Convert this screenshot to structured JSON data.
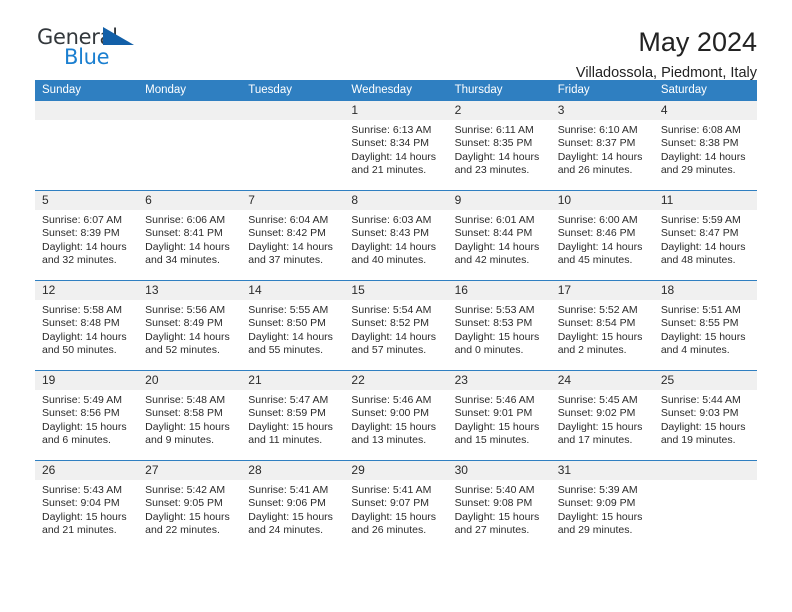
{
  "brand": {
    "name_top": "General",
    "name_bottom": "Blue",
    "triangle_color": "#1360a8",
    "blue_color": "#1b7fd0"
  },
  "header": {
    "month_title": "May 2024",
    "location": "Villadossola, Piedmont, Italy"
  },
  "theme": {
    "header_bg": "#2f7fc1",
    "header_text": "#ffffff",
    "date_band_bg": "#f0f0f0",
    "row_divider": "#2f7fc1"
  },
  "weekdays": [
    "Sunday",
    "Monday",
    "Tuesday",
    "Wednesday",
    "Thursday",
    "Friday",
    "Saturday"
  ],
  "weeks": [
    [
      {
        "day": "",
        "empty": true,
        "sunrise": "",
        "sunset": "",
        "daylight_line1": "",
        "daylight_line2": ""
      },
      {
        "day": "",
        "empty": true,
        "sunrise": "",
        "sunset": "",
        "daylight_line1": "",
        "daylight_line2": ""
      },
      {
        "day": "",
        "empty": true,
        "sunrise": "",
        "sunset": "",
        "daylight_line1": "",
        "daylight_line2": ""
      },
      {
        "day": "1",
        "sunrise": "Sunrise: 6:13 AM",
        "sunset": "Sunset: 8:34 PM",
        "daylight_line1": "Daylight: 14 hours",
        "daylight_line2": "and 21 minutes."
      },
      {
        "day": "2",
        "sunrise": "Sunrise: 6:11 AM",
        "sunset": "Sunset: 8:35 PM",
        "daylight_line1": "Daylight: 14 hours",
        "daylight_line2": "and 23 minutes."
      },
      {
        "day": "3",
        "sunrise": "Sunrise: 6:10 AM",
        "sunset": "Sunset: 8:37 PM",
        "daylight_line1": "Daylight: 14 hours",
        "daylight_line2": "and 26 minutes."
      },
      {
        "day": "4",
        "sunrise": "Sunrise: 6:08 AM",
        "sunset": "Sunset: 8:38 PM",
        "daylight_line1": "Daylight: 14 hours",
        "daylight_line2": "and 29 minutes."
      }
    ],
    [
      {
        "day": "5",
        "sunrise": "Sunrise: 6:07 AM",
        "sunset": "Sunset: 8:39 PM",
        "daylight_line1": "Daylight: 14 hours",
        "daylight_line2": "and 32 minutes."
      },
      {
        "day": "6",
        "sunrise": "Sunrise: 6:06 AM",
        "sunset": "Sunset: 8:41 PM",
        "daylight_line1": "Daylight: 14 hours",
        "daylight_line2": "and 34 minutes."
      },
      {
        "day": "7",
        "sunrise": "Sunrise: 6:04 AM",
        "sunset": "Sunset: 8:42 PM",
        "daylight_line1": "Daylight: 14 hours",
        "daylight_line2": "and 37 minutes."
      },
      {
        "day": "8",
        "sunrise": "Sunrise: 6:03 AM",
        "sunset": "Sunset: 8:43 PM",
        "daylight_line1": "Daylight: 14 hours",
        "daylight_line2": "and 40 minutes."
      },
      {
        "day": "9",
        "sunrise": "Sunrise: 6:01 AM",
        "sunset": "Sunset: 8:44 PM",
        "daylight_line1": "Daylight: 14 hours",
        "daylight_line2": "and 42 minutes."
      },
      {
        "day": "10",
        "sunrise": "Sunrise: 6:00 AM",
        "sunset": "Sunset: 8:46 PM",
        "daylight_line1": "Daylight: 14 hours",
        "daylight_line2": "and 45 minutes."
      },
      {
        "day": "11",
        "sunrise": "Sunrise: 5:59 AM",
        "sunset": "Sunset: 8:47 PM",
        "daylight_line1": "Daylight: 14 hours",
        "daylight_line2": "and 48 minutes."
      }
    ],
    [
      {
        "day": "12",
        "sunrise": "Sunrise: 5:58 AM",
        "sunset": "Sunset: 8:48 PM",
        "daylight_line1": "Daylight: 14 hours",
        "daylight_line2": "and 50 minutes."
      },
      {
        "day": "13",
        "sunrise": "Sunrise: 5:56 AM",
        "sunset": "Sunset: 8:49 PM",
        "daylight_line1": "Daylight: 14 hours",
        "daylight_line2": "and 52 minutes."
      },
      {
        "day": "14",
        "sunrise": "Sunrise: 5:55 AM",
        "sunset": "Sunset: 8:50 PM",
        "daylight_line1": "Daylight: 14 hours",
        "daylight_line2": "and 55 minutes."
      },
      {
        "day": "15",
        "sunrise": "Sunrise: 5:54 AM",
        "sunset": "Sunset: 8:52 PM",
        "daylight_line1": "Daylight: 14 hours",
        "daylight_line2": "and 57 minutes."
      },
      {
        "day": "16",
        "sunrise": "Sunrise: 5:53 AM",
        "sunset": "Sunset: 8:53 PM",
        "daylight_line1": "Daylight: 15 hours",
        "daylight_line2": "and 0 minutes."
      },
      {
        "day": "17",
        "sunrise": "Sunrise: 5:52 AM",
        "sunset": "Sunset: 8:54 PM",
        "daylight_line1": "Daylight: 15 hours",
        "daylight_line2": "and 2 minutes."
      },
      {
        "day": "18",
        "sunrise": "Sunrise: 5:51 AM",
        "sunset": "Sunset: 8:55 PM",
        "daylight_line1": "Daylight: 15 hours",
        "daylight_line2": "and 4 minutes."
      }
    ],
    [
      {
        "day": "19",
        "sunrise": "Sunrise: 5:49 AM",
        "sunset": "Sunset: 8:56 PM",
        "daylight_line1": "Daylight: 15 hours",
        "daylight_line2": "and 6 minutes."
      },
      {
        "day": "20",
        "sunrise": "Sunrise: 5:48 AM",
        "sunset": "Sunset: 8:58 PM",
        "daylight_line1": "Daylight: 15 hours",
        "daylight_line2": "and 9 minutes."
      },
      {
        "day": "21",
        "sunrise": "Sunrise: 5:47 AM",
        "sunset": "Sunset: 8:59 PM",
        "daylight_line1": "Daylight: 15 hours",
        "daylight_line2": "and 11 minutes."
      },
      {
        "day": "22",
        "sunrise": "Sunrise: 5:46 AM",
        "sunset": "Sunset: 9:00 PM",
        "daylight_line1": "Daylight: 15 hours",
        "daylight_line2": "and 13 minutes."
      },
      {
        "day": "23",
        "sunrise": "Sunrise: 5:46 AM",
        "sunset": "Sunset: 9:01 PM",
        "daylight_line1": "Daylight: 15 hours",
        "daylight_line2": "and 15 minutes."
      },
      {
        "day": "24",
        "sunrise": "Sunrise: 5:45 AM",
        "sunset": "Sunset: 9:02 PM",
        "daylight_line1": "Daylight: 15 hours",
        "daylight_line2": "and 17 minutes."
      },
      {
        "day": "25",
        "sunrise": "Sunrise: 5:44 AM",
        "sunset": "Sunset: 9:03 PM",
        "daylight_line1": "Daylight: 15 hours",
        "daylight_line2": "and 19 minutes."
      }
    ],
    [
      {
        "day": "26",
        "sunrise": "Sunrise: 5:43 AM",
        "sunset": "Sunset: 9:04 PM",
        "daylight_line1": "Daylight: 15 hours",
        "daylight_line2": "and 21 minutes."
      },
      {
        "day": "27",
        "sunrise": "Sunrise: 5:42 AM",
        "sunset": "Sunset: 9:05 PM",
        "daylight_line1": "Daylight: 15 hours",
        "daylight_line2": "and 22 minutes."
      },
      {
        "day": "28",
        "sunrise": "Sunrise: 5:41 AM",
        "sunset": "Sunset: 9:06 PM",
        "daylight_line1": "Daylight: 15 hours",
        "daylight_line2": "and 24 minutes."
      },
      {
        "day": "29",
        "sunrise": "Sunrise: 5:41 AM",
        "sunset": "Sunset: 9:07 PM",
        "daylight_line1": "Daylight: 15 hours",
        "daylight_line2": "and 26 minutes."
      },
      {
        "day": "30",
        "sunrise": "Sunrise: 5:40 AM",
        "sunset": "Sunset: 9:08 PM",
        "daylight_line1": "Daylight: 15 hours",
        "daylight_line2": "and 27 minutes."
      },
      {
        "day": "31",
        "sunrise": "Sunrise: 5:39 AM",
        "sunset": "Sunset: 9:09 PM",
        "daylight_line1": "Daylight: 15 hours",
        "daylight_line2": "and 29 minutes."
      },
      {
        "day": "",
        "empty": true,
        "sunrise": "",
        "sunset": "",
        "daylight_line1": "",
        "daylight_line2": ""
      }
    ]
  ]
}
